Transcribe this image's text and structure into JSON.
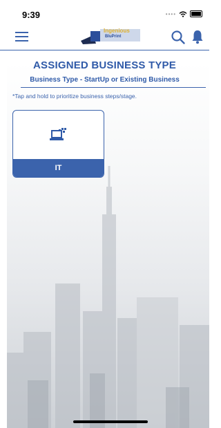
{
  "status": {
    "time": "9:39"
  },
  "header": {
    "logo_line1": "Ingenious",
    "logo_line2": "BluPrint"
  },
  "page": {
    "title": "ASSIGNED BUSINESS TYPE",
    "subtitle": "Business Type - StartUp or Existing Business",
    "hint": "*Tap and hold to prioritize business steps/stage."
  },
  "cards": [
    {
      "label": "IT",
      "icon": "laptop-icon"
    }
  ],
  "colors": {
    "brand_blue": "#3B63AC",
    "gold": "#E0B12C"
  }
}
